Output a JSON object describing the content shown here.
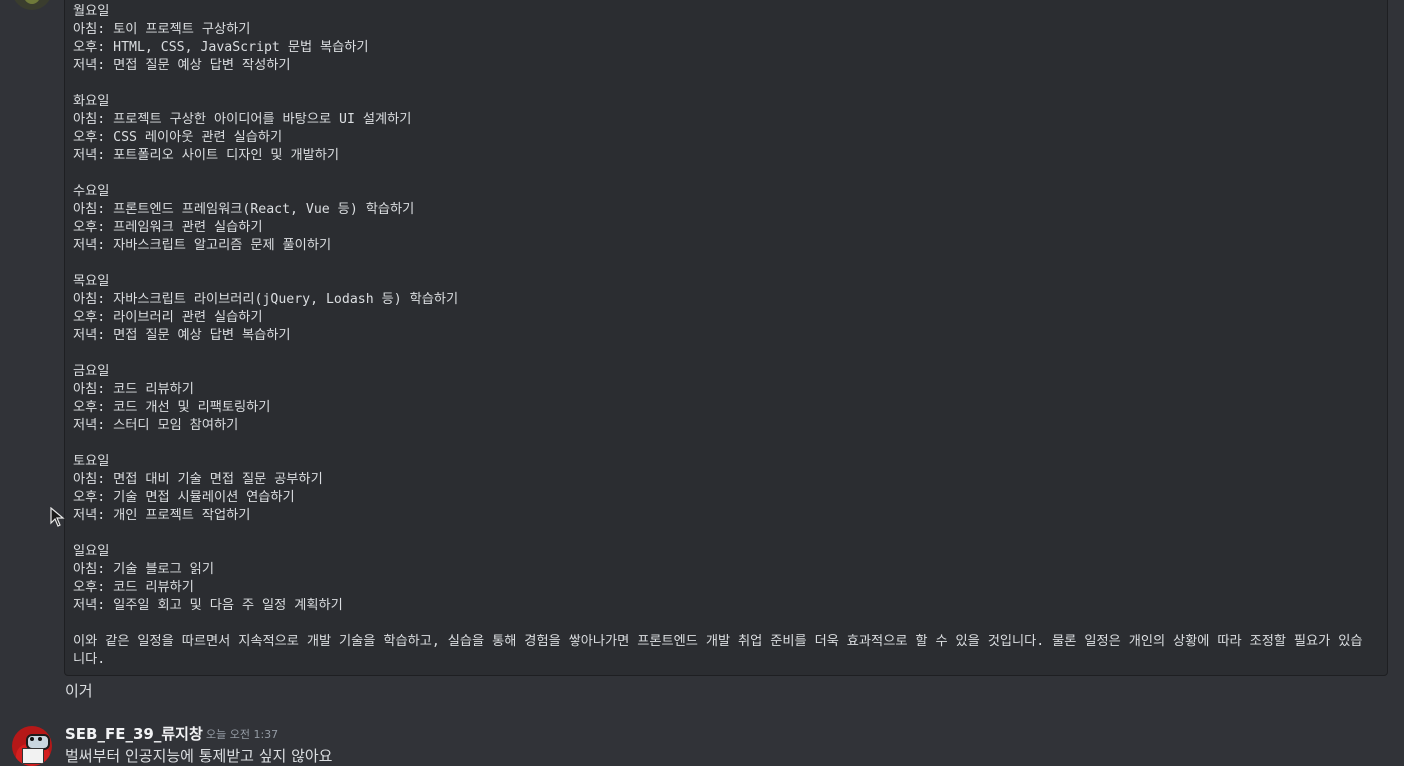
{
  "code_block": {
    "days": [
      {
        "name": "월요일",
        "lines": [
          "아침: 토이 프로젝트 구상하기",
          "오후: HTML, CSS, JavaScript 문법 복습하기",
          "저녁: 면접 질문 예상 답변 작성하기"
        ]
      },
      {
        "name": "화요일",
        "lines": [
          "아침: 프로젝트 구상한 아이디어를 바탕으로 UI 설계하기",
          "오후: CSS 레이아웃 관련 실습하기",
          "저녁: 포트폴리오 사이트 디자인 및 개발하기"
        ]
      },
      {
        "name": "수요일",
        "lines": [
          "아침: 프론트엔드 프레임워크(React, Vue 등) 학습하기",
          "오후: 프레임워크 관련 실습하기",
          "저녁: 자바스크립트 알고리즘 문제 풀이하기"
        ]
      },
      {
        "name": "목요일",
        "lines": [
          "아침: 자바스크립트 라이브러리(jQuery, Lodash 등) 학습하기",
          "오후: 라이브러리 관련 실습하기",
          "저녁: 면접 질문 예상 답변 복습하기"
        ]
      },
      {
        "name": "금요일",
        "lines": [
          "아침: 코드 리뷰하기",
          "오후: 코드 개선 및 리팩토링하기",
          "저녁: 스터디 모임 참여하기"
        ]
      },
      {
        "name": "토요일",
        "lines": [
          "아침: 면접 대비 기술 면접 질문 공부하기",
          "오후: 기술 면접 시뮬레이션 연습하기",
          "저녁: 개인 프로젝트 작업하기"
        ]
      },
      {
        "name": "일요일",
        "lines": [
          "아침: 기술 블로그 읽기",
          "오후: 코드 리뷰하기",
          "저녁: 일주일 회고 및 다음 주 일정 계획하기"
        ]
      }
    ],
    "conclusion": "이와 같은 일정을 따르면서 지속적으로 개발 기술을 학습하고, 실습을 통해 경험을 쌓아나가면 프론트엔드 개발 취업 준비를 더욱 효과적으로 할 수 있을 것입니다. 물론 일정은 개인의 상황에 따라 조정할 필요가 있습니다."
  },
  "followup_text": "이거",
  "message": {
    "username": "SEB_FE_39_류지창",
    "timestamp": "오늘 오전 1:37",
    "text": "벌써부터 인공지능에 통제받고 싶지 않아요"
  },
  "colors": {
    "background": "#313338",
    "code_background": "#2b2d31",
    "text": "#dbdee1",
    "muted": "#949ba4",
    "username": "#f2f3f5",
    "avatar": "#b51818"
  },
  "icons": {
    "cursor": "mouse-pointer-icon"
  }
}
